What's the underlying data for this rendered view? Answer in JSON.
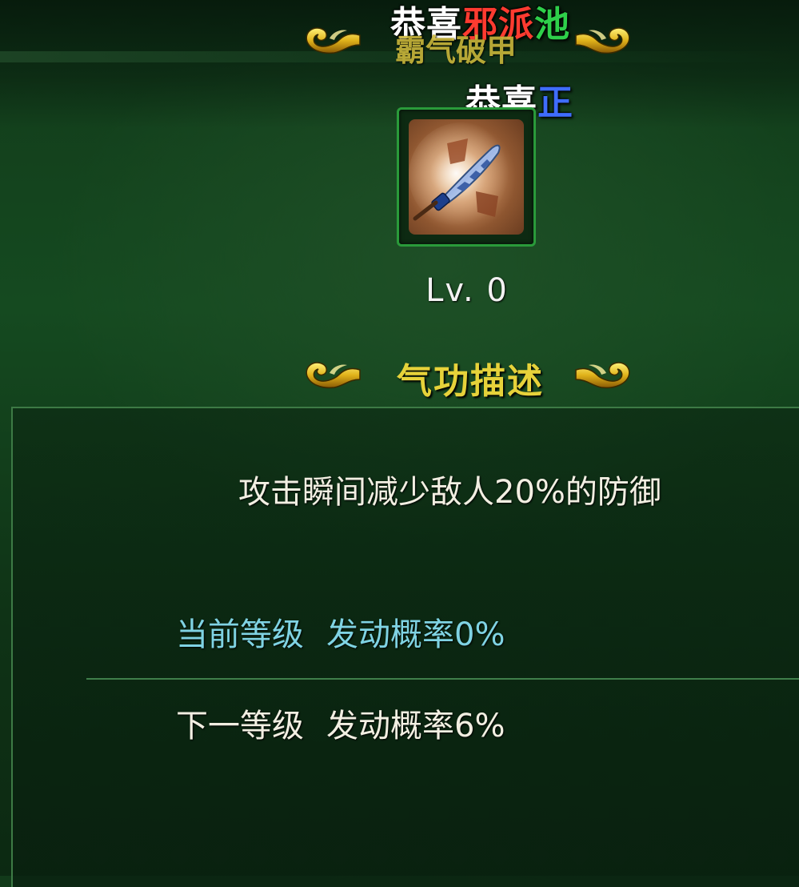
{
  "announcement_1": {
    "prefix": "恭喜",
    "part_red": "邪派",
    "part_green": "池"
  },
  "skill_name": "霸气破甲",
  "announcement_2": {
    "prefix": "恭喜",
    "part_blue": "正"
  },
  "skill_icon": "sword-skill-icon",
  "level_text": "Lv. 0",
  "section_title": "气功描述",
  "description": "攻击瞬间减少敌人20%的防御",
  "current_level": {
    "label": "当前等级",
    "value": "发动概率0%"
  },
  "next_level": {
    "label": "下一等级",
    "value": "发动概率6%"
  },
  "colors": {
    "accent_gold": "#e6d23a",
    "current_cyan": "#7fd3e3",
    "frame_green": "#2a9a3a"
  }
}
